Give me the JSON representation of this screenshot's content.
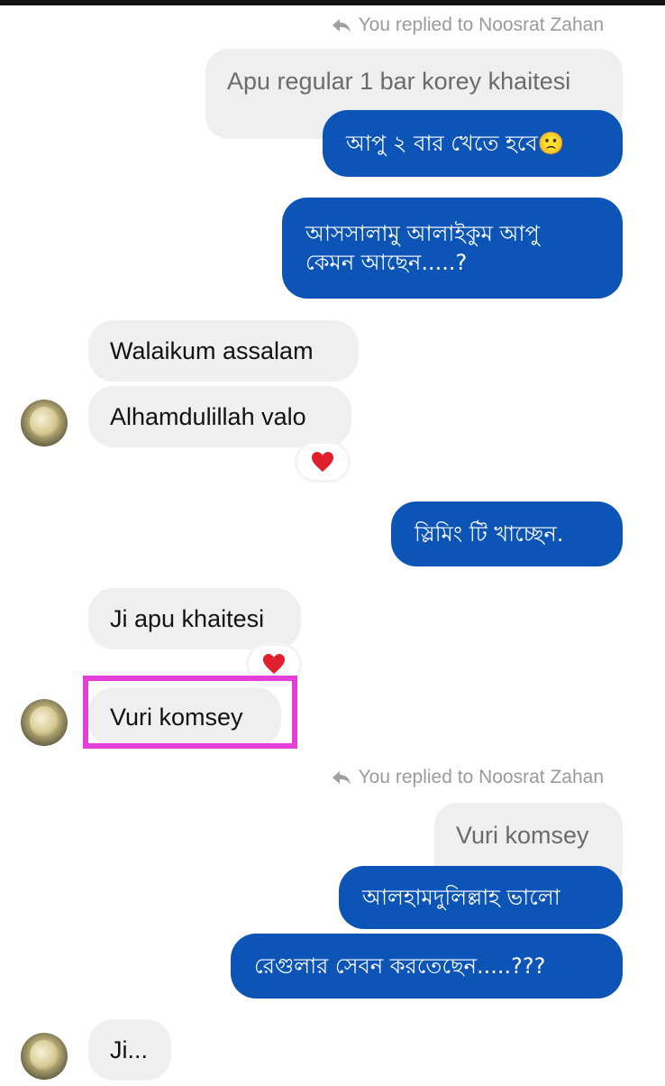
{
  "thread": {
    "reply_note_1": "You replied to Noosrat Zahan",
    "quoted_1": "Apu regular 1 bar korey khaitesi",
    "out_1": "আপু ২ বার খেতে হবে🙁",
    "out_2_line1": "আসসালামু আলাইকুম আপু",
    "out_2_line2": "কেমন আছেন.....?",
    "in_1": "Walaikum assalam",
    "in_2": "Alhamdulillah valo",
    "out_3": "স্লিমিং টি খাচ্ছেন.",
    "in_3": "Ji apu khaitesi",
    "in_4": "Vuri komsey",
    "reply_note_2": "You replied to Noosrat Zahan",
    "quoted_2": "Vuri komsey",
    "out_4": "আলহামদুলিল্লাহ ভালো",
    "out_5": "রেগুলার সেবন করতেছেন.....???",
    "in_5": "Ji..."
  },
  "icons": {
    "reply": "reply-arrow-icon",
    "reaction": "red-heart-icon",
    "avatar": "contact-avatar"
  },
  "colors": {
    "outgoing_bubble": "#0c55b7",
    "incoming_bubble": "#efefef",
    "highlight_box": "#e43fd8",
    "reaction_heart": "#e0202c"
  }
}
